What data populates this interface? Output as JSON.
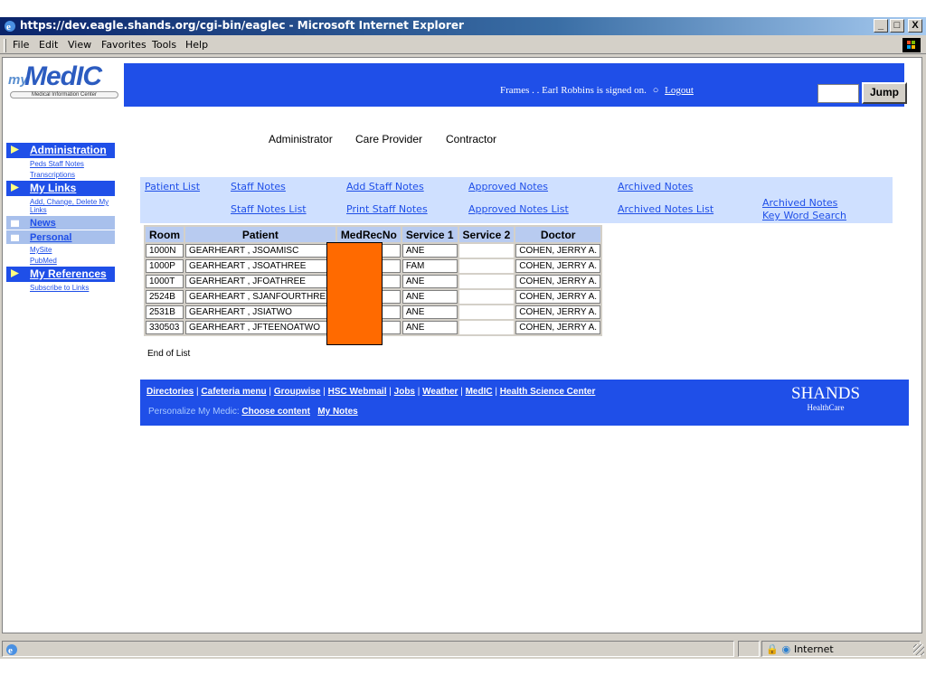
{
  "window": {
    "title": "https://dev.eagle.shands.org/cgi-bin/eaglec - Microsoft Internet Explorer",
    "minimize": "_",
    "maximize": "□",
    "close": "X"
  },
  "menu": [
    "File",
    "Edit",
    "View",
    "Favorites",
    "Tools",
    "Help"
  ],
  "header": {
    "logo_my": "my",
    "logo_medic": "MedIC",
    "logo_subtitle": "Medical Information Center",
    "signed_in_text": "Frames . . Earl Robbins is signed on.",
    "logout_label": "Logout",
    "jump_label": "Jump",
    "tabs": [
      "Administrator",
      "Care Provider",
      "Contractor"
    ]
  },
  "leftnav": {
    "administration": "Administration",
    "admin_items": [
      "Peds Staff Notes",
      "Transcriptions"
    ],
    "mylinks": "My Links",
    "mylinks_items": [
      "Add, Change, Delete My Links"
    ],
    "news": "News",
    "personal": "Personal",
    "personal_items": [
      "MySite",
      "PubMed"
    ],
    "myreferences": "My References",
    "references_items": [
      "Subscribe to Links"
    ]
  },
  "links": {
    "patient_list": "Patient List",
    "staff_notes": "Staff Notes",
    "add_staff_notes": "Add Staff Notes",
    "approved_notes": "Approved Notes",
    "archived_notes": "Archived Notes",
    "staff_notes_list": "Staff Notes List",
    "print_staff_notes": "Print Staff Notes",
    "approved_notes_list": "Approved Notes List",
    "archived_notes_list": "Archived Notes List",
    "archived_kw_1": "Archived Notes",
    "archived_kw_2": "Key Word Search"
  },
  "table": {
    "headers": [
      "Room",
      "Patient",
      "MedRecNo",
      "Service 1",
      "Service 2",
      "Doctor"
    ],
    "rows": [
      [
        "1000N",
        "GEARHEART , JSOAMISC",
        "",
        "ANE",
        "",
        "COHEN, JERRY A."
      ],
      [
        "1000P",
        "GEARHEART , JSOATHREE",
        "",
        "FAM",
        "",
        "COHEN, JERRY A."
      ],
      [
        "1000T",
        "GEARHEART , JFOATHREE",
        "",
        "ANE",
        "",
        "COHEN, JERRY A."
      ],
      [
        "2524B",
        "GEARHEART , SJANFOURTHREE",
        "",
        "ANE",
        "",
        "COHEN, JERRY A."
      ],
      [
        "2531B",
        "GEARHEART , JSIATWO",
        "",
        "ANE",
        "",
        "COHEN, JERRY A."
      ],
      [
        "330503",
        "GEARHEART , JFTEENOATWO",
        "",
        "ANE",
        "",
        "COHEN, JERRY A."
      ]
    ],
    "end_text": "End of List"
  },
  "footer": {
    "links": [
      "Directories",
      "Cafeteria menu",
      "Groupwise",
      "HSC Webmail",
      "Jobs",
      "Weather",
      "MedIC",
      "Health Science Center"
    ],
    "personalize_text": "Personalize My Medic:",
    "choose_content": "Choose content",
    "my_notes": "My Notes",
    "shands_big": "SHANDS",
    "shands_small": "HealthCare"
  },
  "statusbar": {
    "zone": "Internet"
  },
  "colors": {
    "brand_blue": "#1f4fe8",
    "redaction": "#ff6a00"
  }
}
